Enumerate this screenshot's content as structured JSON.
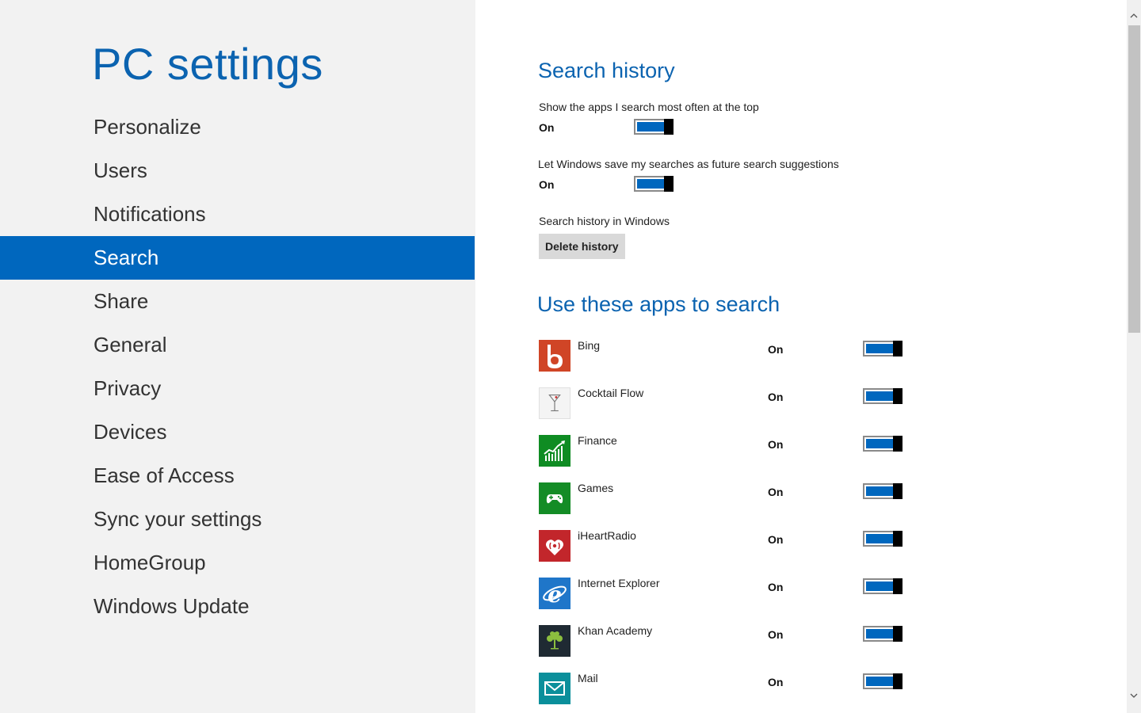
{
  "app": {
    "title": "PC settings"
  },
  "nav": {
    "items": [
      {
        "label": "Personalize"
      },
      {
        "label": "Users"
      },
      {
        "label": "Notifications"
      },
      {
        "label": "Search",
        "selected": true
      },
      {
        "label": "Share"
      },
      {
        "label": "General"
      },
      {
        "label": "Privacy"
      },
      {
        "label": "Devices"
      },
      {
        "label": "Ease of Access"
      },
      {
        "label": "Sync your settings"
      },
      {
        "label": "HomeGroup"
      },
      {
        "label": "Windows Update"
      }
    ]
  },
  "search_history": {
    "title": "Search history",
    "settings": [
      {
        "label": "Show the apps I search most often at the top",
        "state": "On"
      },
      {
        "label": "Let Windows save my searches as future search suggestions",
        "state": "On"
      }
    ],
    "history_label": "Search history in Windows",
    "delete_button": "Delete history"
  },
  "apps_section": {
    "title": "Use these apps to search",
    "apps": [
      {
        "name": "Bing",
        "state": "On",
        "icon": "bing-icon",
        "color": "#d04526"
      },
      {
        "name": "Cocktail Flow",
        "state": "On",
        "icon": "cocktail-glass-icon",
        "color": "#f4f4f4"
      },
      {
        "name": "Finance",
        "state": "On",
        "icon": "finance-chart-icon",
        "color": "#0f8c23"
      },
      {
        "name": "Games",
        "state": "On",
        "icon": "game-controller-icon",
        "color": "#148c26"
      },
      {
        "name": "iHeartRadio",
        "state": "On",
        "icon": "iheartradio-icon",
        "color": "#c2262b"
      },
      {
        "name": "Internet Explorer",
        "state": "On",
        "icon": "internet-explorer-icon",
        "color": "#1f76c9"
      },
      {
        "name": "Khan Academy",
        "state": "On",
        "icon": "khan-academy-tree-icon",
        "color": "#1f2a33"
      },
      {
        "name": "Mail",
        "state": "On",
        "icon": "mail-envelope-icon",
        "color": "#0b8f9b"
      }
    ]
  },
  "colors": {
    "accent": "#0067be",
    "title": "#0b63b0",
    "nav_background": "#f2f2f2"
  }
}
